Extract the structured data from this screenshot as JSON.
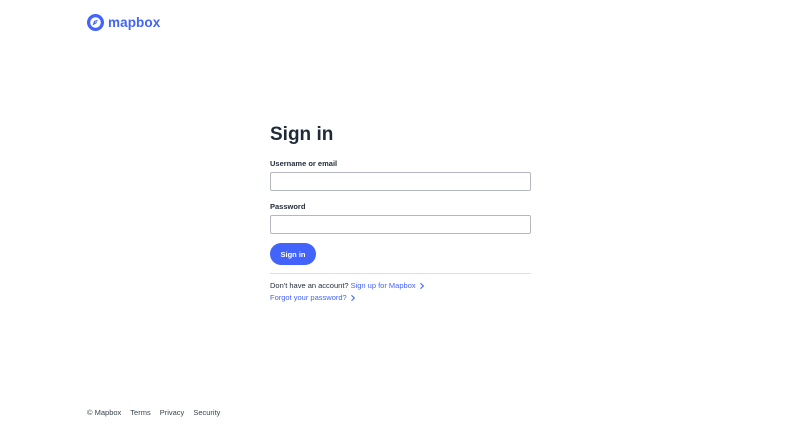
{
  "header": {
    "brand": "mapbox",
    "brand_color": "#4264fb"
  },
  "signin": {
    "title": "Sign in",
    "username_label": "Username or email",
    "username_value": "",
    "password_label": "Password",
    "password_value": "",
    "submit_label": "Sign in",
    "no_account_text": "Don't have an account?",
    "signup_link": "Sign up for Mapbox",
    "forgot_link": "Forgot your password?",
    "link_icon": "chevron-right-icon"
  },
  "footer": {
    "copyright": "© Mapbox",
    "links": [
      "Terms",
      "Privacy",
      "Security"
    ]
  }
}
